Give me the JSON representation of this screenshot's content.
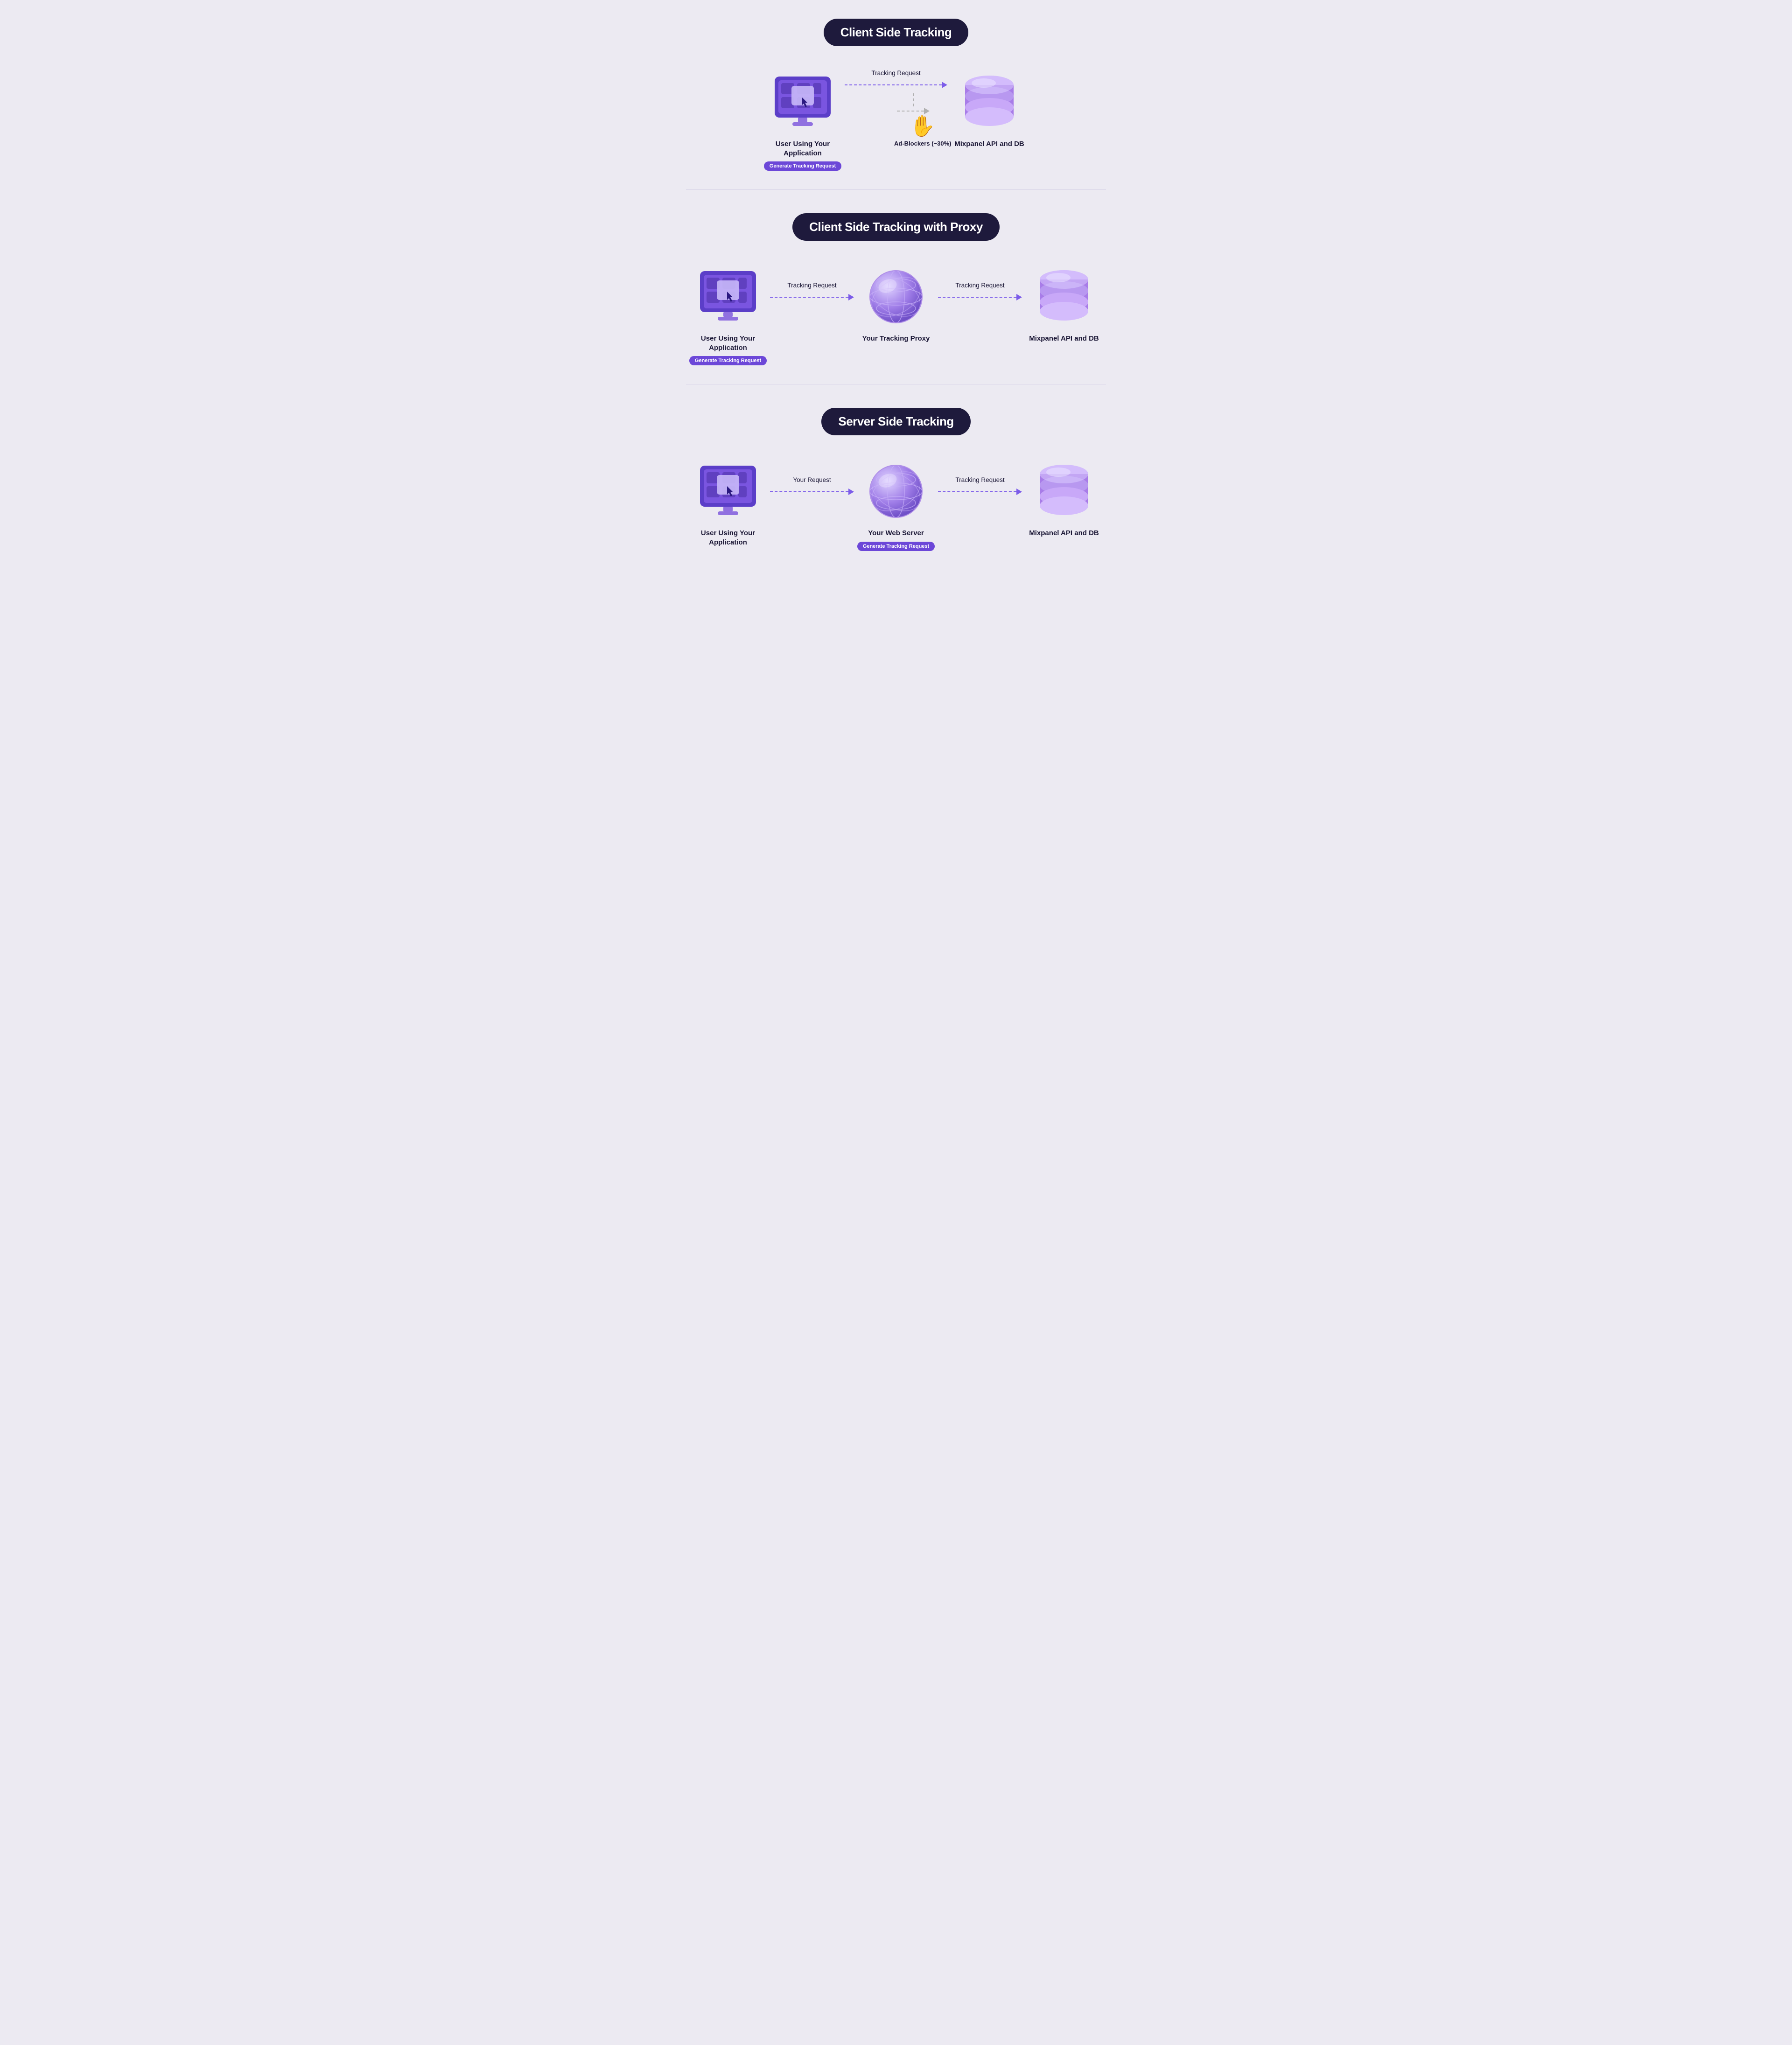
{
  "sections": [
    {
      "id": "client-side",
      "title": "Client Side Tracking",
      "nodes": [
        {
          "id": "user-app-1",
          "type": "monitor",
          "label": "User Using Your Application",
          "badge": "Generate Tracking Request"
        },
        {
          "id": "mixpanel-1",
          "type": "db",
          "label": "Mixpanel API and DB",
          "badge": null
        }
      ],
      "connector_type": "adblocker",
      "connector": {
        "top_label": "Tracking Request",
        "adblocker_label": "Ad-Blockers (~30%)",
        "main_arrow_color": "purple",
        "fork_arrow_color": "gray"
      }
    },
    {
      "id": "client-side-proxy",
      "title": "Client Side Tracking with Proxy",
      "nodes": [
        {
          "id": "user-app-2",
          "type": "monitor",
          "label": "User Using Your Application",
          "badge": "Generate Tracking Request"
        },
        {
          "id": "proxy",
          "type": "globe",
          "label": "Your Tracking Proxy",
          "badge": null
        },
        {
          "id": "mixpanel-2",
          "type": "db",
          "label": "Mixpanel API and DB",
          "badge": null
        }
      ],
      "connector_type": "simple",
      "connectors": [
        {
          "label": "Tracking Request"
        },
        {
          "label": "Tracking Request"
        }
      ]
    },
    {
      "id": "server-side",
      "title": "Server Side Tracking",
      "nodes": [
        {
          "id": "user-app-3",
          "type": "monitor",
          "label": "User Using Your Application",
          "badge": null
        },
        {
          "id": "web-server",
          "type": "globe",
          "label": "Your Web Server",
          "badge": "Generate Tracking Request"
        },
        {
          "id": "mixpanel-3",
          "type": "db",
          "label": "Mixpanel API and DB",
          "badge": null
        }
      ],
      "connector_type": "simple",
      "connectors": [
        {
          "label": "Your Request"
        },
        {
          "label": "Tracking Request"
        }
      ]
    }
  ]
}
